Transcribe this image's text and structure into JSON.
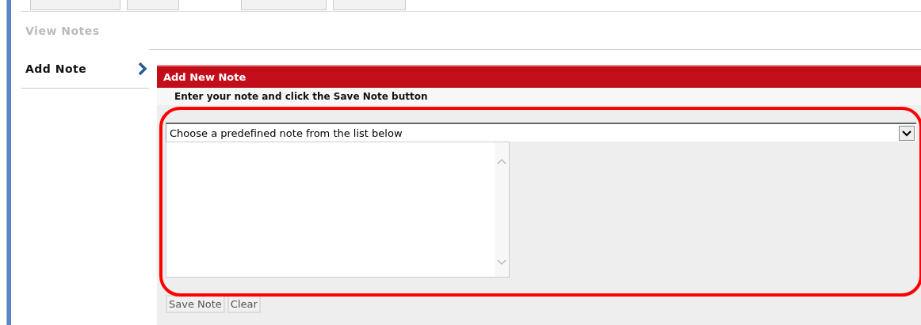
{
  "sidebar": {
    "items": [
      {
        "label": "View Notes",
        "selected": false
      },
      {
        "label": "Add Note",
        "selected": true
      }
    ]
  },
  "panel": {
    "title": "Add New Note",
    "instruction": "Enter your note and click the Save Note button",
    "dropdown": {
      "value": "Choose a predefined note from the list below"
    },
    "highlighted": true
  },
  "buttons": [
    "Save Note",
    "Clear"
  ]
}
